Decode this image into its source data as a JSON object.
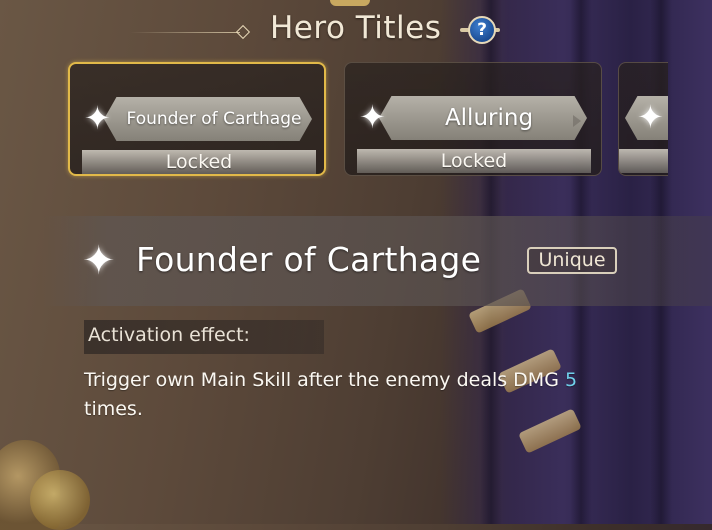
{
  "header": {
    "title": "Hero Titles",
    "help_label": "?"
  },
  "title_cards": [
    {
      "name": "Founder of Carthage",
      "status": "Locked",
      "selected": true,
      "icon": "sparkle-star-icon"
    },
    {
      "name": "Alluring",
      "status": "Locked",
      "selected": false,
      "icon": "sparkle-star-icon"
    },
    {
      "name": "",
      "status": "",
      "selected": false,
      "icon": "sparkle-star-icon"
    }
  ],
  "detail": {
    "icon": "sparkle-star-icon",
    "title": "Founder of Carthage",
    "badge": "Unique",
    "effect_header": "Activation effect:",
    "effect_text_before": "Trigger own Main Skill after the enemy deals DMG ",
    "effect_count": "5",
    "effect_text_after": " times."
  },
  "colors": {
    "selected_border": "#e1b949",
    "highlight_number": "#6fd0ea",
    "help_button": "#1b4c94"
  }
}
